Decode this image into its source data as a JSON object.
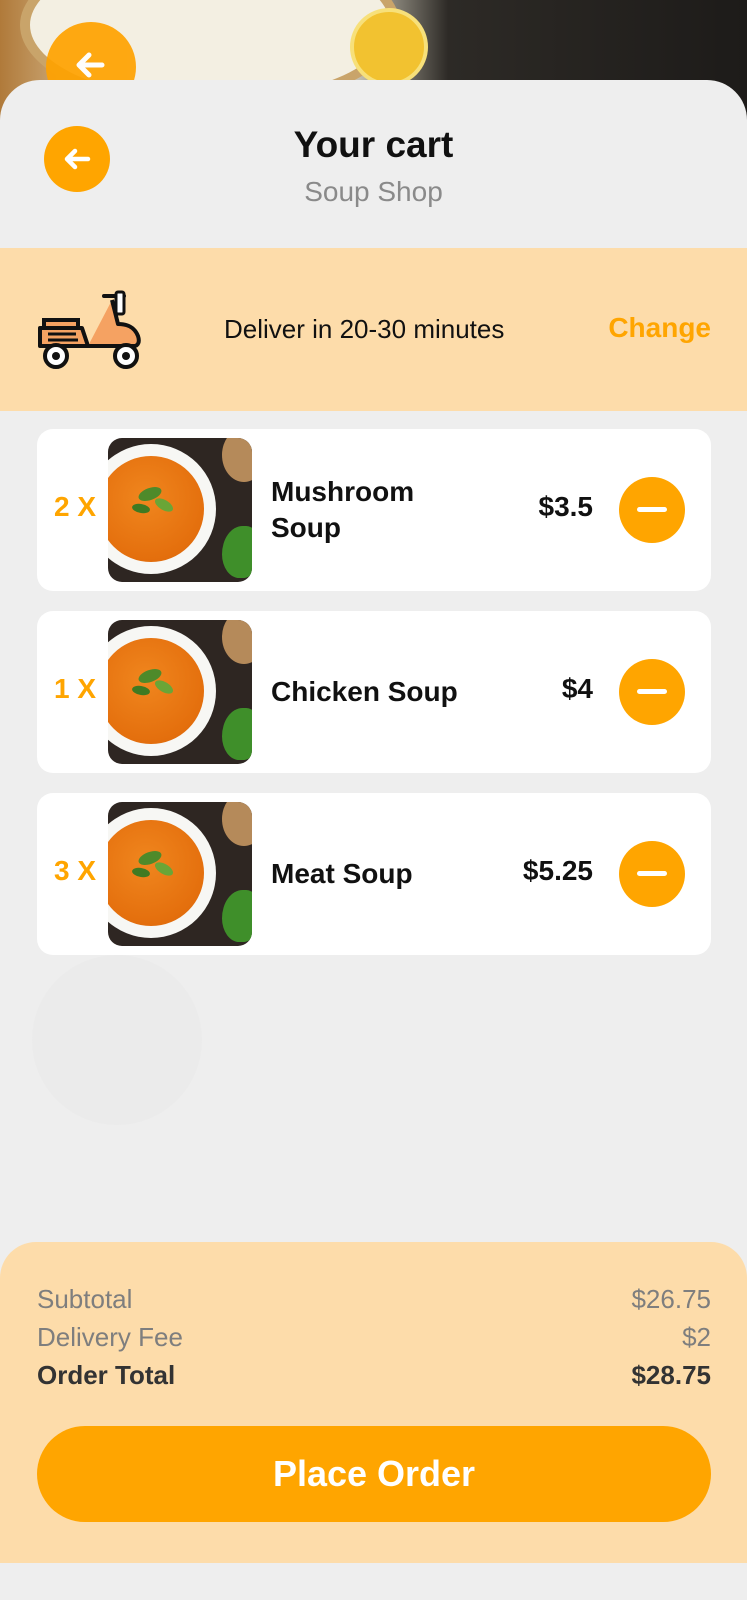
{
  "header": {
    "title": "Your cart",
    "subtitle": "Soup Shop"
  },
  "delivery": {
    "text": "Deliver in 20-30 minutes",
    "change_label": "Change"
  },
  "items": [
    {
      "qty": "2 X",
      "name": "Mushroom Soup",
      "price": "$3.5"
    },
    {
      "qty": "1 X",
      "name": "Chicken Soup",
      "price": "$4"
    },
    {
      "qty": "3 X",
      "name": "Meat Soup",
      "price": "$5.25"
    }
  ],
  "summary": {
    "subtotal_label": "Subtotal",
    "subtotal_value": "$26.75",
    "fee_label": "Delivery Fee",
    "fee_value": "$2",
    "total_label": "Order Total",
    "total_value": "$28.75"
  },
  "place_order_label": "Place Order",
  "colors": {
    "accent": "#ffa500",
    "band": "#fddcaa",
    "background": "#eeeeee"
  },
  "icons": [
    "arrow-left-icon",
    "scooter-icon",
    "minus-icon"
  ]
}
